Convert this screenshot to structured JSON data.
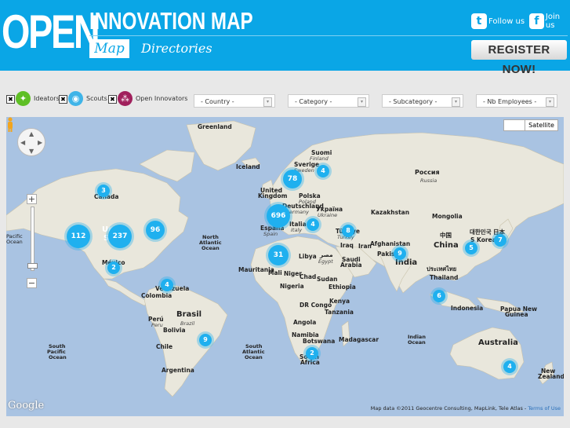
{
  "header": {
    "logo_open": "OPEN",
    "logo_sub": "INNOVATION MAP",
    "nav": {
      "map": "Map",
      "directories": "Directories"
    },
    "follow_label": "Follow us",
    "join_label": "Join us",
    "twitter_glyph": "t",
    "facebook_glyph": "f",
    "register_label": "REGISTER NOW!"
  },
  "filters": {
    "categories": [
      {
        "label": "Ideators",
        "icon": "lightbulb-icon",
        "color": "#5fbf25",
        "checked": true
      },
      {
        "label": "Scouts",
        "icon": "scout-icon",
        "color": "#3fb4e8",
        "checked": true
      },
      {
        "label": "Open Innovators",
        "icon": "open-innovators-icon",
        "color": "#a0205c",
        "checked": true
      }
    ],
    "selects": {
      "country": "- Country -",
      "category": "- Category -",
      "subcategory": "- Subcategory -",
      "employees": "- Nb Employees -"
    }
  },
  "map": {
    "type_satellite": "Satellite",
    "google_logo": "Google",
    "credits": "Map data ©2011 Geocentre Consulting, MapLink, Tele Atlas - ",
    "terms": "Terms of Use",
    "clusters": [
      {
        "count": "3"
      },
      {
        "count": "78"
      },
      {
        "count": "4"
      },
      {
        "count": "696"
      },
      {
        "count": "4"
      },
      {
        "count": "8"
      },
      {
        "count": "112"
      },
      {
        "count": "237"
      },
      {
        "count": "96"
      },
      {
        "count": "31"
      },
      {
        "count": "9"
      },
      {
        "count": "5"
      },
      {
        "count": "7"
      },
      {
        "count": "2"
      },
      {
        "count": "4"
      },
      {
        "count": "6"
      },
      {
        "count": "9"
      },
      {
        "count": "2"
      },
      {
        "count": "4"
      }
    ],
    "labels": {
      "greenland": "Greenland",
      "iceland": "Iceland",
      "canada": "Canada",
      "suomi": "Suomi",
      "finland": "Finland",
      "sverige": "Sverige",
      "sweden": "Sweden",
      "russia_native": "Россия",
      "russia": "Russia",
      "uk1": "United",
      "uk2": "Kingdom",
      "polska": "Polska",
      "poland": "Poland",
      "germany": "Deutschland",
      "germany2": "Germany",
      "ukraine_native": "Україна",
      "ukraine": "Ukraine",
      "kazakhstan": "Kazakhstan",
      "mongolia": "Mongolia",
      "espana": "España",
      "spain": "Spain",
      "italia": "Italia",
      "italy": "Italy",
      "turkiye": "Türkiye",
      "turkey": "Turkey",
      "iraq": "Iraq",
      "iran": "Iran",
      "afghanistan": "Afghanistan",
      "pakistan": "Pakistan",
      "china_native": "中国",
      "china": "China",
      "korea_native": "대한민국",
      "skorea": "S Korea",
      "japan_native": "日本",
      "pacific1": "Pacific",
      "pacific2": "Ocean",
      "united_s1": "Un",
      "united_s2": "S",
      "north_atl1": "North",
      "north_atl2": "Atlantic",
      "north_atl3": "Ocean",
      "mexico": "México",
      "libya": "Libya",
      "egypt_native": "مصر",
      "egypt": "Egypt",
      "saudi1": "Saudi",
      "saudi2": "Arabia",
      "india": "India",
      "mauritania": "Mauritania",
      "mali": "Mali",
      "niger": "Niger",
      "chad": "Chad",
      "sudan": "Sudan",
      "nigeria": "Nigeria",
      "ethiopia": "Ethiopia",
      "thailand_native": "ประเทศไทย",
      "thailand": "Thailand",
      "venezuela": "Venezuela",
      "colombia": "Colombia",
      "kenya": "Kenya",
      "drcongo": "DR Congo",
      "tanzania": "Tanzania",
      "indonesia": "Indonesia",
      "papua1": "Papua New",
      "papua2": "Guinea",
      "peru": "Perú",
      "peru2": "Peru",
      "brasil": "Brasil",
      "brazil": "Brazil",
      "bolivia": "Bolivia",
      "angola": "Angola",
      "namibia": "Namibia",
      "botswana": "Botswana",
      "madagascar": "Madagascar",
      "indian1": "Indian",
      "indian2": "Ocean",
      "chile": "Chile",
      "argentina": "Argentina",
      "south_pac1": "South",
      "south_pac2": "Pacific",
      "south_pac3": "Ocean",
      "south_atl1": "South",
      "south_atl2": "Atlantic",
      "south_atl3": "Ocean",
      "south_africa1": "South",
      "south_africa2": "Africa",
      "australia": "Australia",
      "nz1": "New",
      "nz2": "Zealand"
    }
  }
}
